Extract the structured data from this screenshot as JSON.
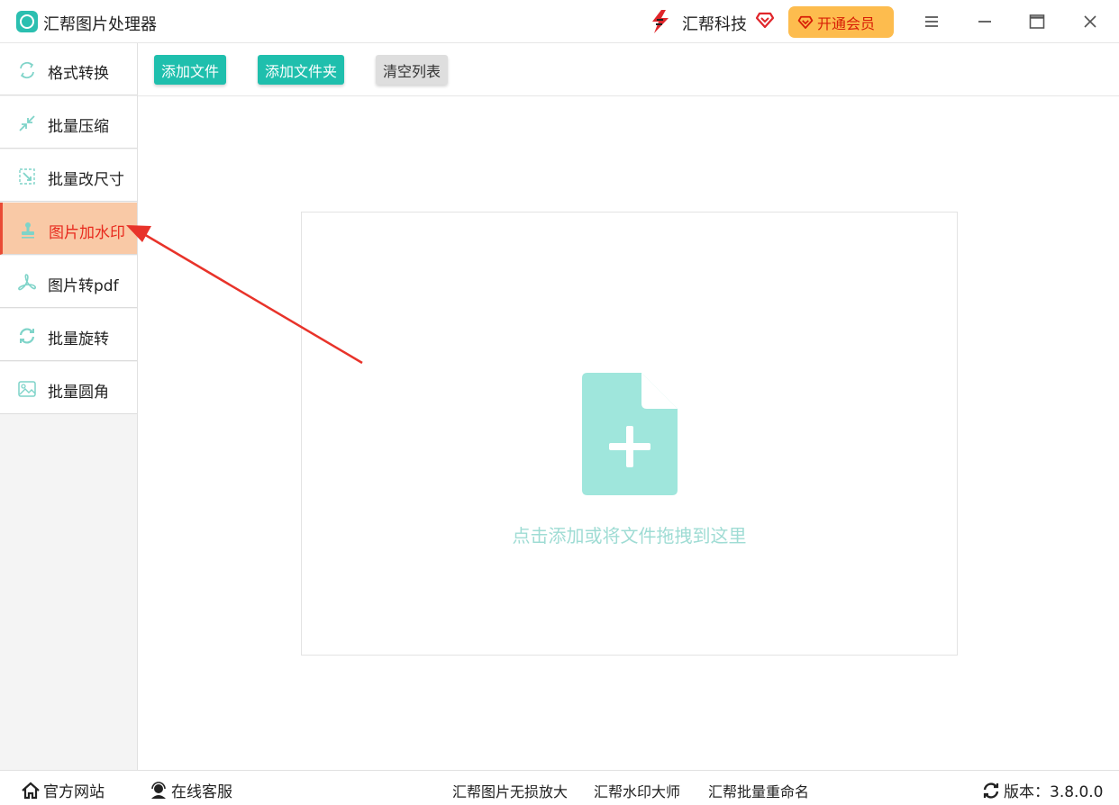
{
  "window": {
    "app_title": "汇帮图片处理器",
    "brand_name": "汇帮科技",
    "vip_label": "开通会员",
    "icons": [
      "app-logo-icon",
      "brand-logo-icon",
      "diamond-heart-icon",
      "menu-icon",
      "minimize-icon",
      "maximize-icon",
      "close-icon"
    ],
    "accent_color": "#1fbfad",
    "vip_color": "#fdbc4e"
  },
  "sidebar": {
    "items": [
      {
        "label": "格式转换",
        "icon": "format-convert-icon",
        "active": false
      },
      {
        "label": "批量压缩",
        "icon": "compress-icon",
        "active": false
      },
      {
        "label": "批量改尺寸",
        "icon": "resize-icon",
        "active": false
      },
      {
        "label": "图片加水印",
        "icon": "watermark-stamp-icon",
        "active": true
      },
      {
        "label": "图片转pdf",
        "icon": "pdf-icon",
        "active": false
      },
      {
        "label": "批量旋转",
        "icon": "rotate-icon",
        "active": false
      },
      {
        "label": "批量圆角",
        "icon": "rounded-image-icon",
        "active": false
      }
    ],
    "active_color": "#f9c9a6",
    "active_text_color": "#e82a1e"
  },
  "toolbar": {
    "add_file": "添加文件",
    "add_folder": "添加文件夹",
    "clear_list": "清空列表"
  },
  "dropzone": {
    "hint": "点击添加或将文件拖拽到这里",
    "icon": "add-file-icon",
    "icon_color": "#9fe6dc"
  },
  "footer": {
    "website": "官方网站",
    "support": "在线客服",
    "links": [
      "汇帮图片无损放大",
      "汇帮水印大师",
      "汇帮批量重命名"
    ],
    "version": "版本：3.8.0.0"
  }
}
